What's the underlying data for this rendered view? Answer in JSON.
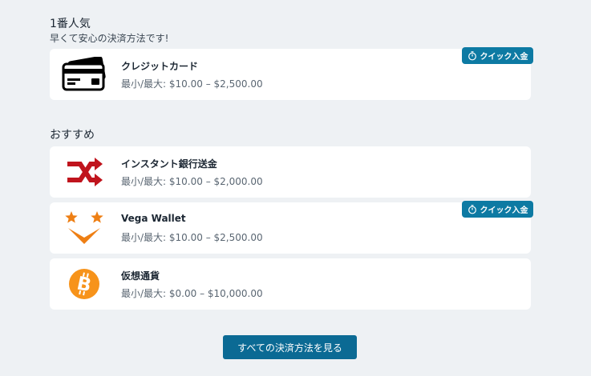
{
  "popular": {
    "title": "1番人気",
    "subtitle": "早くて安心の決済方法です!"
  },
  "recommended": {
    "title": "おすすめ"
  },
  "badge_label": "クイック入金",
  "methods": [
    {
      "name": "クレジットカード",
      "limits": "最小/最大: $10.00 – $2,500.00",
      "icon": "credit-card-icon",
      "quick_deposit": true
    },
    {
      "name": "インスタント銀行送金",
      "limits": "最小/最大: $10.00 – $2,000.00",
      "icon": "shuffle-arrows-icon",
      "quick_deposit": false
    },
    {
      "name": "Vega Wallet",
      "limits": "最小/最大: $10.00 – $2,500.00",
      "icon": "vega-wallet-icon",
      "quick_deposit": true
    },
    {
      "name": "仮想通貨",
      "limits": "最小/最大: $0.00 – $10,000.00",
      "icon": "bitcoin-icon",
      "quick_deposit": false
    }
  ],
  "cta_label": "すべての決済方法を見る",
  "colors": {
    "background": "#eef1f4",
    "card": "#ffffff",
    "badge": "#0d7aa3",
    "cta": "#0b6a94",
    "shuffle_red": "#c0141d",
    "vega_orange": "#ee7f14",
    "bitcoin_orange": "#f7931a"
  }
}
